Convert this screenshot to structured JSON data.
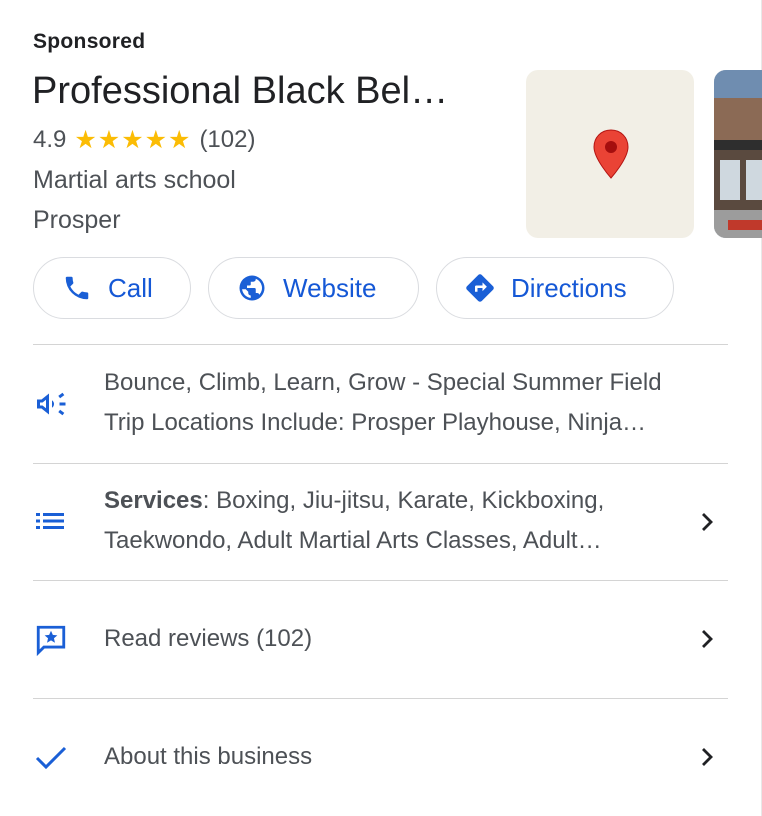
{
  "sponsored_label": "Sponsored",
  "business": {
    "title": "Professional Black Bel…",
    "rating": "4.9",
    "stars": "★★★★★",
    "review_count": "(102)",
    "category": "Martial arts school",
    "location": "Prosper"
  },
  "actions": {
    "call_label": "Call",
    "website_label": "Website",
    "directions_label": "Directions"
  },
  "rows": {
    "promo_line1": "Bounce, Climb, Learn, Grow - Special Summer Field",
    "promo_line2": "Trip Locations Include: Prosper Playhouse, Ninja…",
    "services_label": "Services",
    "services_line1_rest": ": Boxing, Jiu-jitsu, Karate, Kickboxing,",
    "services_line2": "Taekwondo, Adult Martial Arts Classes, Adult…",
    "reviews_label": "Read reviews (102)",
    "about_label": "About this business"
  },
  "colors": {
    "accent_blue": "#1a5fd6",
    "star_yellow": "#fbbc04",
    "map_pin_red": "#ea4335"
  },
  "icons": {
    "call": "phone-icon",
    "website": "globe-icon",
    "directions": "directions-icon",
    "promo": "megaphone-icon",
    "services": "list-icon",
    "reviews": "review-star-icon",
    "about": "checkmark-icon",
    "chevron": "chevron-right-icon",
    "map": "map-pin-icon"
  }
}
